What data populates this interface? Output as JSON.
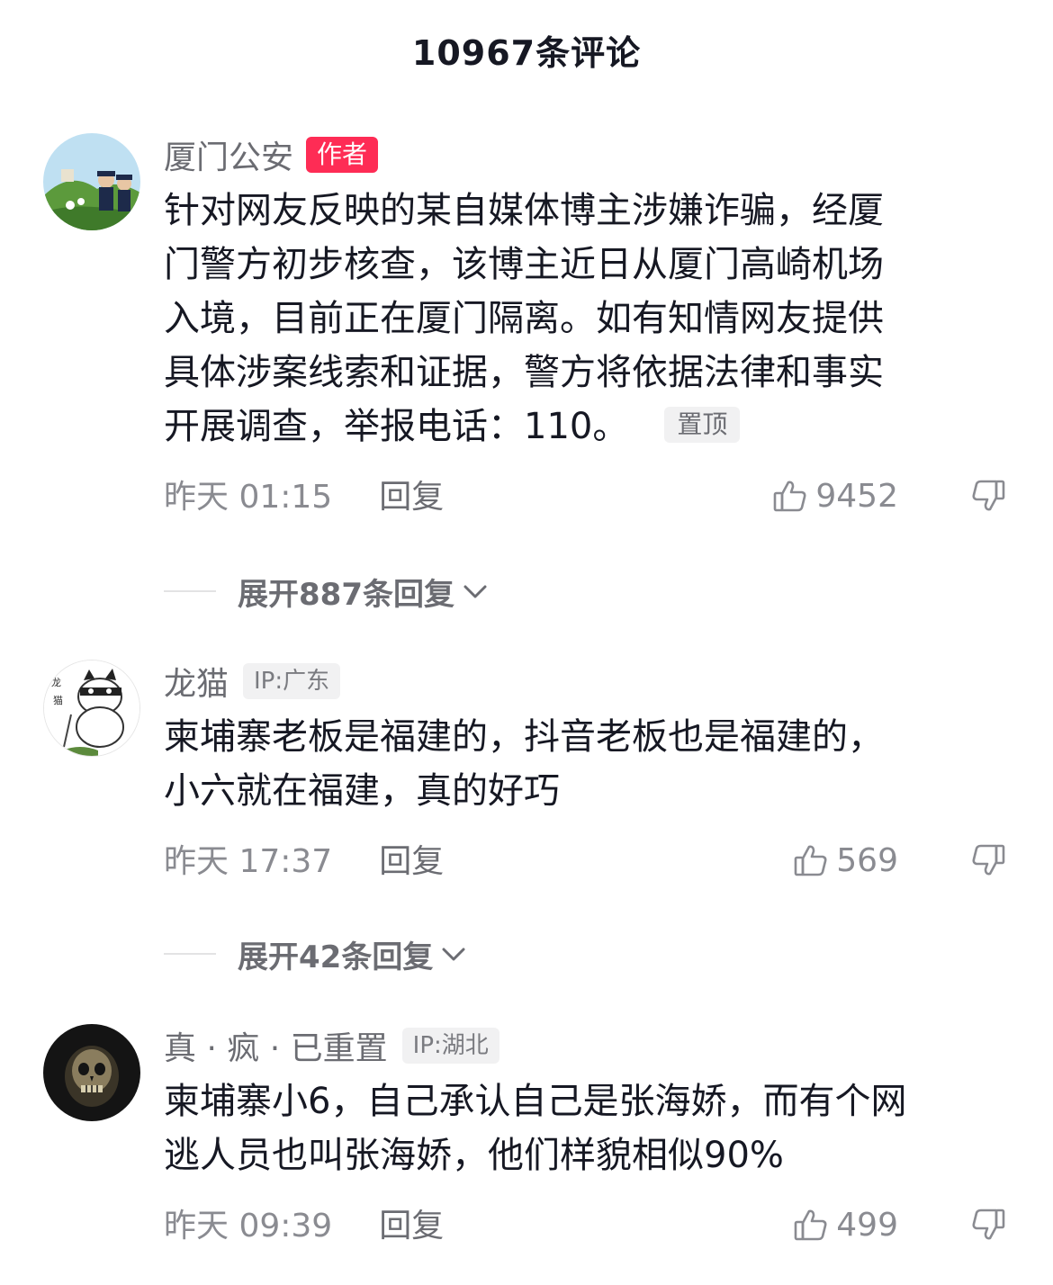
{
  "header": {
    "title": "10967条评论"
  },
  "comments": [
    {
      "username": "厦门公安",
      "author_badge": "作者",
      "ip": "",
      "lines": [
        "针对网友反映的某自媒体博主涉嫌诈骗，经厦",
        "门警方初步核查，该博主近日从厦门高崎机场",
        "入境，目前正在厦门隔离。如有知情网友提供",
        "具体涉案线索和证据，警方将依据法律和事实",
        "开展调查，举报电话：110。"
      ],
      "pin_badge": "置顶",
      "time": "昨天 01:15",
      "reply_label": "回复",
      "likes": "9452",
      "expand_label": "展开887条回复",
      "avatar_icon": "police-avatar-icon"
    },
    {
      "username": "龙猫",
      "ip": "IP:广东",
      "lines": [
        "柬埔寨老板是福建的，抖音老板也是福建的，",
        "小六就在福建，真的好巧"
      ],
      "time": "昨天 17:37",
      "reply_label": "回复",
      "likes": "569",
      "expand_label": "展开42条回复",
      "avatar_icon": "cartoon-golfer-avatar-icon"
    },
    {
      "username": "真 · 疯 · 已重置",
      "ip": "IP:湖北",
      "lines": [
        "柬埔寨小6，自己承认自己是张海娇，而有个网",
        "逃人员也叫张海娇，他们样貌相似90%"
      ],
      "time": "昨天 09:39",
      "reply_label": "回复",
      "likes": "499",
      "avatar_icon": "skull-avatar-icon"
    }
  ],
  "colors": {
    "accent": "#fe2c55",
    "text_primary": "#161823",
    "text_secondary": "#6b6c72",
    "text_meta": "#8a8b91",
    "badge_bg": "#f1f1f2"
  }
}
